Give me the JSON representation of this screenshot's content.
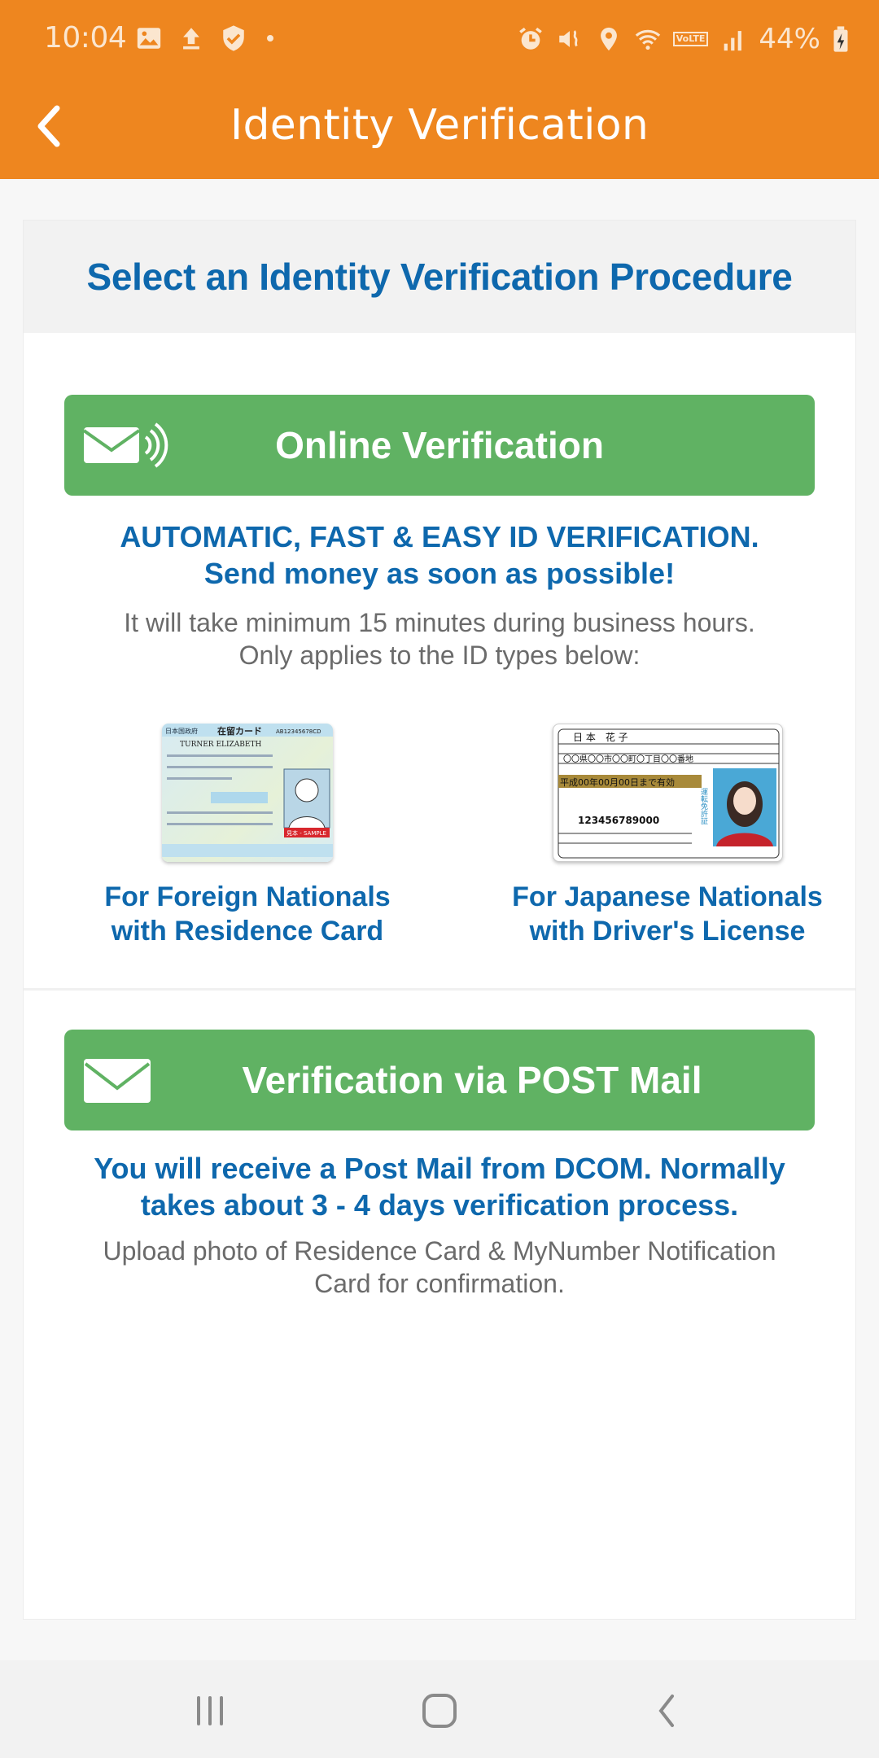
{
  "status_bar": {
    "time": "10:04",
    "left_icons": [
      "gallery-icon",
      "upload-icon",
      "shield-check-icon",
      "notification-dot"
    ],
    "right_icons": [
      "alarm-icon",
      "vibrate-icon",
      "location-icon",
      "wifi-icon",
      "volte-icon",
      "signal-icon"
    ],
    "volte_label": "VoLTE",
    "battery": "44%"
  },
  "toolbar": {
    "title": "Identity Verification",
    "back_icon": "chevron-left-icon"
  },
  "colors": {
    "brand_orange": "#ee861f",
    "button_green": "#60b263",
    "heading_blue": "#0e68ad",
    "body_grey": "#6b6b6b"
  },
  "main": {
    "heading": "Select an Identity Verification Procedure",
    "online": {
      "button_label": "Online Verification",
      "button_icon": "email-wireless-icon",
      "highlight_line1": "AUTOMATIC, FAST & EASY ID VERIFICATION.",
      "highlight_line2": "Send money as soon as possible!",
      "note_line1": "It will take minimum 15 minutes during business hours.",
      "note_line2": "Only applies to the ID types below:",
      "id_types": [
        {
          "caption_line1": "For Foreign Nationals",
          "caption_line2": "with Residence Card",
          "image": "residence-card-sample",
          "card_text": {
            "title": "在留カード",
            "name": "TURNER ELIZABETH",
            "number": "AB12345678CD",
            "sample": "見本 - SAMPLE"
          }
        },
        {
          "caption_line1": "For Japanese Nationals",
          "caption_line2": "with Driver's License",
          "image": "drivers-license-sample",
          "card_text": {
            "name": "日 本　花 子",
            "validity": "平成00年00月00日まで有効",
            "number": "123456789000",
            "label": "運転免許証"
          }
        }
      ]
    },
    "post": {
      "button_label": "Verification via POST Mail",
      "button_icon": "envelope-icon",
      "highlight_line1": "You will receive a Post Mail from DCOM. Normally",
      "highlight_line2": "takes about 3 - 4 days verification process.",
      "note_line1": "Upload photo of Residence Card & MyNumber Notification",
      "note_line2": "Card for confirmation."
    }
  },
  "nav_bar": {
    "recent": "recent-apps-icon",
    "home": "home-icon",
    "back": "back-icon"
  }
}
